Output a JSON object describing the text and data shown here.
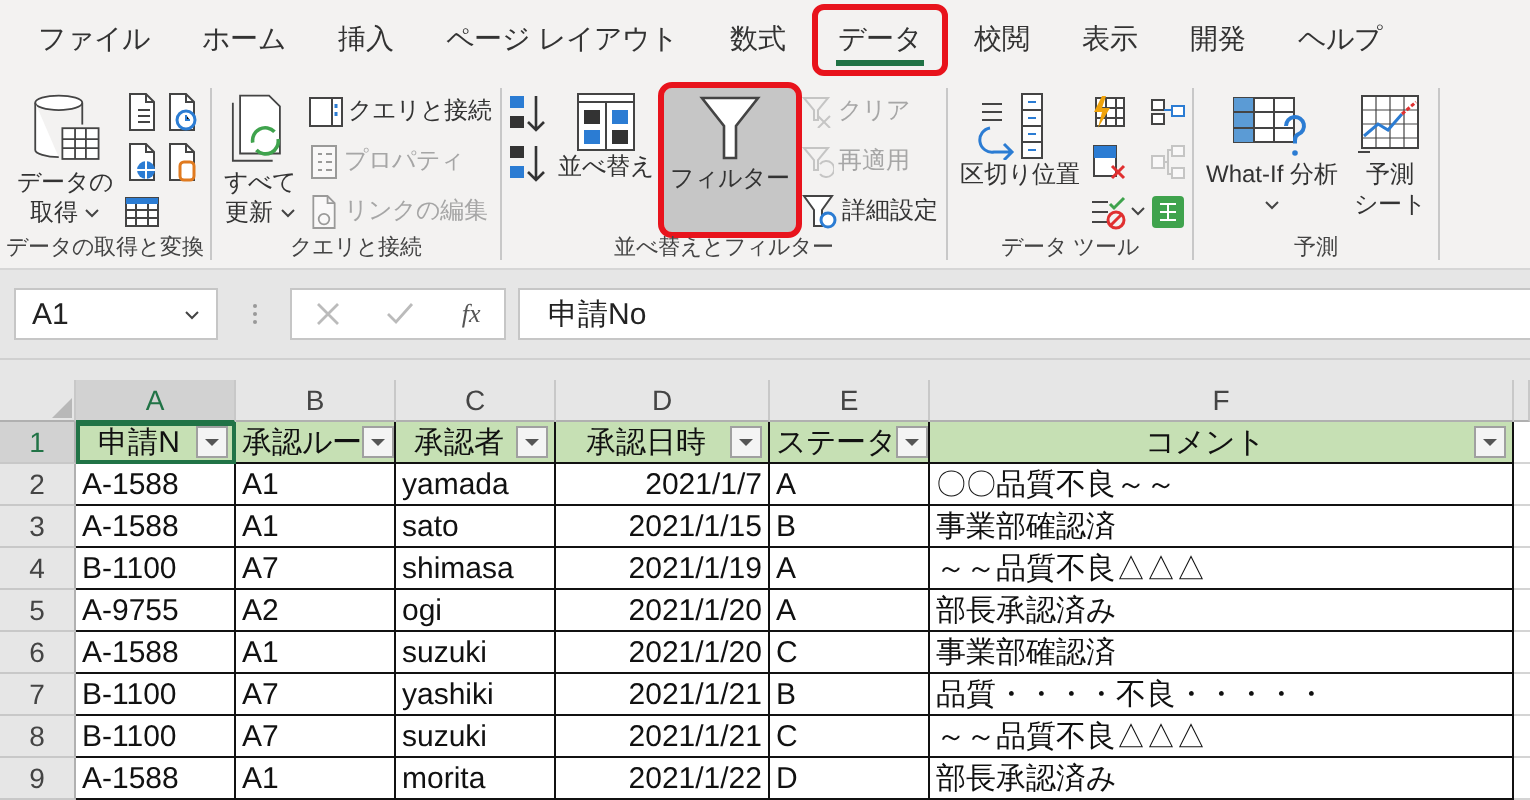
{
  "menu_tabs": [
    {
      "label": "ファイル",
      "selected": false,
      "highlighted": false
    },
    {
      "label": "ホーム",
      "selected": false,
      "highlighted": false
    },
    {
      "label": "挿入",
      "selected": false,
      "highlighted": false
    },
    {
      "label": "ページ レイアウト",
      "selected": false,
      "highlighted": false
    },
    {
      "label": "数式",
      "selected": false,
      "highlighted": false
    },
    {
      "label": "データ",
      "selected": true,
      "highlighted": true
    },
    {
      "label": "校閲",
      "selected": false,
      "highlighted": false
    },
    {
      "label": "表示",
      "selected": false,
      "highlighted": false
    },
    {
      "label": "開発",
      "selected": false,
      "highlighted": false
    },
    {
      "label": "ヘルプ",
      "selected": false,
      "highlighted": false
    }
  ],
  "ribbon_groups": [
    {
      "label": "データの取得と変換",
      "items": [
        {
          "kind": "large",
          "lines": [
            "データの",
            "取得"
          ],
          "dropdown": true,
          "pressed": false,
          "highlighted": false
        },
        {
          "kind": "stack",
          "items": [
            {
              "disabled": false
            },
            {
              "disabled": false
            },
            {
              "disabled": false
            }
          ]
        },
        {
          "kind": "stack",
          "items": [
            {
              "disabled": false
            },
            {
              "disabled": false
            }
          ]
        }
      ]
    },
    {
      "label": "クエリと接続",
      "items": [
        {
          "kind": "large",
          "lines": [
            "すべて",
            "更新"
          ],
          "dropdown": true,
          "pressed": false,
          "highlighted": false
        },
        {
          "kind": "stack",
          "items": [
            {
              "label": "クエリと接続",
              "disabled": false
            },
            {
              "label": "プロパティ",
              "disabled": true
            },
            {
              "label": "リンクの編集",
              "disabled": true
            }
          ]
        }
      ]
    },
    {
      "label": "並べ替えとフィルター",
      "items": [
        {
          "kind": "stack",
          "items": [
            {
              "disabled": false
            },
            {
              "disabled": false
            }
          ]
        },
        {
          "kind": "large",
          "lines": [
            "並べ替え"
          ],
          "dropdown": false,
          "pressed": false,
          "highlighted": false
        },
        {
          "kind": "large",
          "lines": [
            "フィルター"
          ],
          "dropdown": false,
          "pressed": true,
          "highlighted": true
        },
        {
          "kind": "stack",
          "items": [
            {
              "label": "クリア",
              "disabled": true
            },
            {
              "label": "再適用",
              "disabled": true
            },
            {
              "label": "詳細設定",
              "disabled": false
            }
          ]
        }
      ]
    },
    {
      "label": "データ ツール",
      "items": [
        {
          "kind": "large",
          "lines": [
            "区切り位置"
          ],
          "dropdown": false,
          "pressed": false,
          "highlighted": false
        },
        {
          "kind": "stack",
          "items": [
            {
              "disabled": false
            },
            {
              "disabled": false
            },
            {
              "disabled": false,
              "dropdown": true
            }
          ]
        },
        {
          "kind": "stack",
          "items": [
            {
              "disabled": false
            },
            {
              "disabled": true
            },
            {
              "disabled": false
            }
          ]
        }
      ]
    },
    {
      "label": "予測",
      "items": [
        {
          "kind": "large",
          "lines": [
            "What-If 分析"
          ],
          "dropdown": true,
          "pressed": false,
          "highlighted": false
        },
        {
          "kind": "large",
          "lines": [
            "予測",
            "シート"
          ],
          "dropdown": false,
          "pressed": false,
          "highlighted": false
        }
      ]
    }
  ],
  "formula_bar": {
    "name_box": "A1",
    "function_label": "fx",
    "formula": "申請No"
  },
  "sheet": {
    "columns": [
      {
        "label": "A",
        "selected": true
      },
      {
        "label": "B",
        "selected": false
      },
      {
        "label": "C",
        "selected": false
      },
      {
        "label": "D",
        "selected": false
      },
      {
        "label": "E",
        "selected": false
      },
      {
        "label": "F",
        "selected": false
      }
    ],
    "header_row": {
      "number": "1",
      "selected": true,
      "cells": [
        {
          "text": "申請N",
          "filter": true,
          "active": true
        },
        {
          "text": "承認ルー",
          "filter": true,
          "active": false
        },
        {
          "text": "承認者",
          "filter": true,
          "active": false
        },
        {
          "text": "承認日時",
          "filter": true,
          "active": false
        },
        {
          "text": "ステータ",
          "filter": true,
          "active": false
        },
        {
          "text": "コメント",
          "filter": true,
          "active": false
        }
      ]
    },
    "rows": [
      {
        "number": "2",
        "cells": [
          "A-1588",
          "A1",
          "yamada",
          "2021/1/7",
          "A",
          "〇〇品質不良～～"
        ]
      },
      {
        "number": "3",
        "cells": [
          "A-1588",
          "A1",
          "sato",
          "2021/1/15",
          "B",
          "事業部確認済"
        ]
      },
      {
        "number": "4",
        "cells": [
          "B-1100",
          "A7",
          "shimasa",
          "2021/1/19",
          "A",
          "～～品質不良△△△"
        ]
      },
      {
        "number": "5",
        "cells": [
          "A-9755",
          "A2",
          "ogi",
          "2021/1/20",
          "A",
          "部長承認済み"
        ]
      },
      {
        "number": "6",
        "cells": [
          "A-1588",
          "A1",
          "suzuki",
          "2021/1/20",
          "C",
          "事業部確認済"
        ]
      },
      {
        "number": "7",
        "cells": [
          "B-1100",
          "A7",
          "yashiki",
          "2021/1/21",
          "B",
          "品質・・・・不良・・・・・"
        ]
      },
      {
        "number": "8",
        "cells": [
          "B-1100",
          "A7",
          "suzuki",
          "2021/1/21",
          "C",
          "～～品質不良△△△"
        ]
      },
      {
        "number": "9",
        "cells": [
          "A-1588",
          "A1",
          "morita",
          "2021/1/22",
          "D",
          "部長承認済み"
        ]
      }
    ]
  }
}
